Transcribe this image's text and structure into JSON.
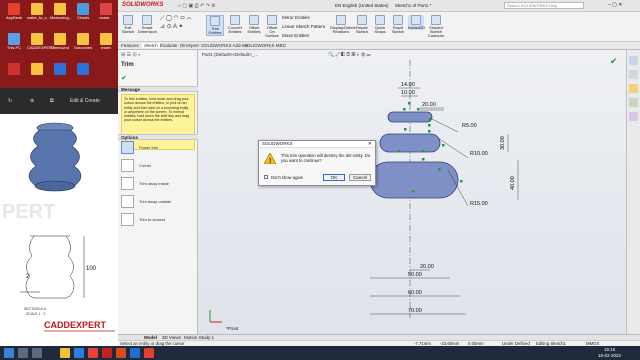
{
  "desktop": {
    "icons": [
      {
        "label": "AnyDesk",
        "color": "#e3402e"
      },
      {
        "label": "water_to_c...",
        "color": "#f6c343"
      },
      {
        "label": "Measuring...",
        "color": "#f6c343"
      },
      {
        "label": "Clouds",
        "color": "#4b9be0"
      },
      {
        "label": "exam...",
        "color": "#d44"
      },
      {
        "label": "This PC",
        "color": "#5aa0e6"
      },
      {
        "label": "CADDEXPERT",
        "color": "#f6c343"
      },
      {
        "label": "DemoUnd",
        "color": "#f6c343"
      },
      {
        "label": "Outcomes",
        "color": "#f6c343"
      },
      {
        "label": "exam",
        "color": "#f6c343"
      },
      {
        "label": "",
        "color": "#c33"
      },
      {
        "label": "",
        "color": "#f6c343"
      },
      {
        "label": "",
        "color": "#2f6fd8"
      },
      {
        "label": "",
        "color": "#2f6fd8"
      }
    ]
  },
  "remote": {
    "edit_create": "Edit & Create"
  },
  "cad_image": {
    "watermark": "PERT",
    "section": "SECTION A-A",
    "scale": "SCALE 1 : 2",
    "dim_100": "100",
    "dim_2": "2",
    "brand": "CADDEXPERT"
  },
  "sw": {
    "logo": "SOLIDWORKS",
    "doc_title": "Sketch1 of Part1 *",
    "language": "EN English (United States)",
    "search_placeholder": "Search SOLIDWORKS Help",
    "ribbon": [
      {
        "label": "Exit Sketch"
      },
      {
        "label": "Smart Dimension"
      },
      {
        "label": "Trim Entities"
      },
      {
        "label": "Convert Entities"
      },
      {
        "label": "Offset Entities"
      },
      {
        "label": "Offset On Surface"
      }
    ],
    "ribbon_small": [
      "Mirror Entities",
      "Linear Sketch Pattern",
      "Move Entities"
    ],
    "ribbon_right": [
      {
        "label": "Display/Delete Relations"
      },
      {
        "label": "Repair Sketch"
      },
      {
        "label": "Quick Snaps"
      },
      {
        "label": "Rapid Sketch"
      },
      {
        "label": "Instant2D"
      },
      {
        "label": "Shaded Sketch Contours"
      }
    ],
    "tabs": [
      "Features",
      "Sketch",
      "Evaluate",
      "DimXpert",
      "SOLIDWORKS Add-Ins",
      "SOLIDWORKS MBD"
    ],
    "tree_label": "Part1  (Default<<Default>_...",
    "pm": {
      "title": "Trim",
      "message_header": "Message",
      "message": "To trim entities, hold down and drag your cursor across the entities, or pick on an entity and then pick on a bounding entity or anywhere on the screen. To extend entities, hold down the shift key and drag your cursor across the entities.",
      "options_header": "Options",
      "options": [
        "Power trim",
        "Corner",
        "Trim away inside",
        "Trim away outside",
        "Trim to closest"
      ]
    },
    "dims": {
      "d14": "14.00",
      "d10": "10.00",
      "d20a": "20.00",
      "r5": "R5.00",
      "r10": "R10.00",
      "d30": "30.00",
      "r15": "R15.00",
      "d40": "40.00",
      "d20b": "20.00",
      "d50": "50.00",
      "d60": "60.00",
      "d70": "70.00"
    },
    "view_label": "*Front",
    "bottom_tabs": [
      "Model",
      "3D Views",
      "Motion Study 1"
    ],
    "status": {
      "hint": "Select an entity or drag the cursor",
      "x": "-7.71mm",
      "y": "-23.60mm",
      "z": "0.00mm",
      "state": "Under Defined",
      "editing": "Editing Sketch1",
      "units": "MMGS"
    },
    "dialog": {
      "title": "SOLIDWORKS",
      "message": "This trim operation will destroy the dot entity. Do you want to continue?",
      "dont_show": "Don't show again",
      "ok": "OK",
      "cancel": "Cancel"
    }
  },
  "taskbar": {
    "time": "15:15",
    "date": "16-02-2022"
  },
  "colors": {
    "shape_fill": "#7f90c6",
    "shape_stroke": "#2f3f7a",
    "relation_green": "#1a9d2e",
    "dialog_warning": "#f3c21a"
  }
}
